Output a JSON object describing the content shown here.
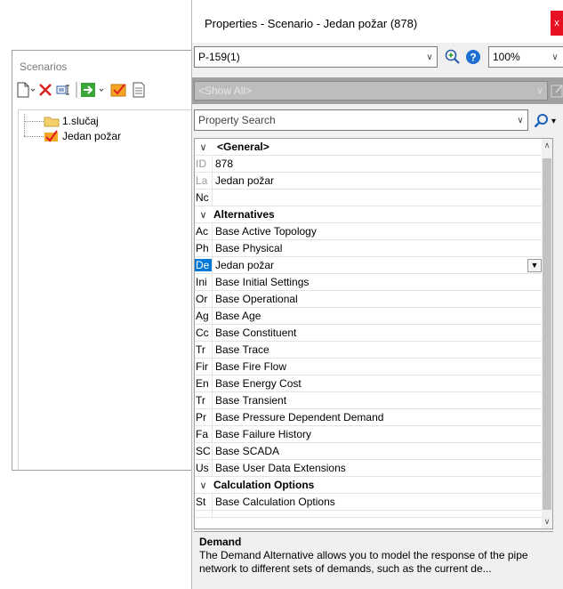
{
  "scenarios": {
    "title": "Scenarios",
    "tree": [
      {
        "label": "1.slučaj",
        "icon": "folder-icon"
      },
      {
        "label": "Jedan požar",
        "icon": "checkmark-icon"
      }
    ]
  },
  "properties": {
    "title": "Properties - Scenario - Jedan požar (878)",
    "close_label": "x",
    "element_select": "P-159(1)",
    "zoom": "100%",
    "filter": "<Show All>",
    "search_placeholder": "Property Search",
    "groups": [
      {
        "label": "<General>",
        "rows": [
          {
            "name": "ID",
            "value": "878"
          },
          {
            "name": "La",
            "value": "Jedan požar"
          },
          {
            "name": "Nc",
            "value": ""
          }
        ]
      },
      {
        "label": "Alternatives",
        "rows": [
          {
            "name": "Ac",
            "value": "Base Active Topology"
          },
          {
            "name": "Ph",
            "value": "Base Physical"
          },
          {
            "name": "De",
            "value": "Jedan požar"
          },
          {
            "name": "Ini",
            "value": "Base Initial Settings"
          },
          {
            "name": "Or",
            "value": "Base Operational"
          },
          {
            "name": "Ag",
            "value": "Base Age"
          },
          {
            "name": "Cc",
            "value": "Base Constituent"
          },
          {
            "name": "Tr",
            "value": "Base Trace"
          },
          {
            "name": "Fir",
            "value": "Base Fire Flow"
          },
          {
            "name": "En",
            "value": "Base Energy Cost"
          },
          {
            "name": "Tr",
            "value": "Base Transient"
          },
          {
            "name": "Pr",
            "value": "Base Pressure Dependent Demand"
          },
          {
            "name": "Fa",
            "value": "Base Failure History"
          },
          {
            "name": "SC",
            "value": "Base SCADA"
          },
          {
            "name": "Us",
            "value": "Base User Data Extensions"
          }
        ]
      },
      {
        "label": "Calculation Options",
        "rows": [
          {
            "name": "St",
            "value": "Base Calculation Options"
          }
        ]
      }
    ],
    "description": {
      "title": "Demand",
      "body": "The Demand Alternative allows you to model the response of the pipe network to different sets of demands, such as the current de..."
    }
  }
}
